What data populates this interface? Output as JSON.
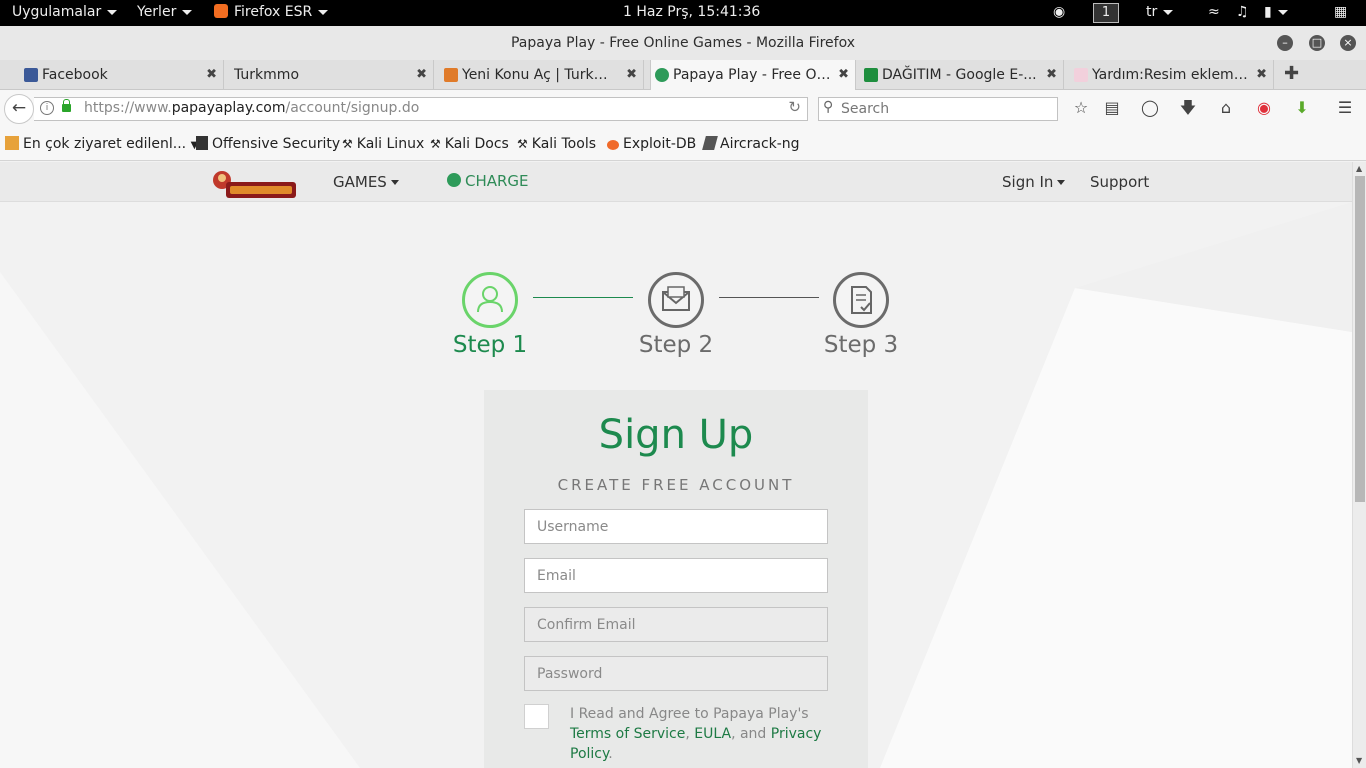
{
  "system_bar": {
    "applications": "Uygulamalar",
    "places": "Yerler",
    "active_app": "Firefox ESR",
    "clock": "1 Haz Prş, 15:41:36",
    "workspace": "1",
    "keyboard_layout": "tr"
  },
  "window": {
    "title": "Papaya Play - Free Online Games - Mozilla Firefox"
  },
  "tabs": [
    {
      "label": "Facebook",
      "favicon": "facebook-icon",
      "color": "#3b5998"
    },
    {
      "label": "Turkmmo",
      "favicon": "none",
      "color": ""
    },
    {
      "label": "Yeni Konu Aç | Turkm...",
      "favicon": "turkmmo-icon",
      "color": "#e07b2a"
    },
    {
      "label": "Papaya Play - Free On...",
      "favicon": "papaya-icon",
      "color": "#2e9b5a",
      "active": true
    },
    {
      "label": "DAĞITIM - Google E-...",
      "favicon": "sheets-icon",
      "color": "#1e8e3e"
    },
    {
      "label": "Yardım:Resim ekleme ...",
      "favicon": "wiki-icon",
      "color": "#cc3366"
    }
  ],
  "navbar": {
    "url_dim": "https://www.",
    "url_host": "papayaplay.com",
    "url_path": "/account/signup.do",
    "search_placeholder": "Search"
  },
  "bookmarks": [
    {
      "label": "En çok ziyaret edilenl...",
      "icon": "folder-icon"
    },
    {
      "label": "Offensive Security",
      "icon": "offsec-icon"
    },
    {
      "label": "Kali Linux",
      "icon": "kali-icon"
    },
    {
      "label": "Kali Docs",
      "icon": "kali-icon"
    },
    {
      "label": "Kali Tools",
      "icon": "kali-icon"
    },
    {
      "label": "Exploit-DB",
      "icon": "exploitdb-icon"
    },
    {
      "label": "Aircrack-ng",
      "icon": "aircrack-icon"
    }
  ],
  "site": {
    "nav": {
      "games": "GAMES",
      "charge": "CHARGE",
      "sign_in": "Sign In",
      "support": "Support"
    },
    "steps": [
      {
        "label": "Step 1",
        "icon": "user-icon",
        "active": true
      },
      {
        "label": "Step 2",
        "icon": "envelope-icon",
        "active": false
      },
      {
        "label": "Step 3",
        "icon": "document-check-icon",
        "active": false
      }
    ],
    "signup": {
      "title": "Sign Up",
      "subtitle": "CREATE FREE ACCOUNT",
      "username_placeholder": "Username",
      "email_placeholder": "Email",
      "confirm_email_placeholder": "Confirm Email",
      "password_placeholder": "Password",
      "agree_prefix": "I Read and Agree to Papaya Play's",
      "terms_link": "Terms of Service",
      "comma": ",",
      "eula_link": "EULA",
      "and_text": ", and",
      "privacy_link": "Privacy Policy",
      "period": "."
    }
  },
  "colors": {
    "accent_green": "#1d8a4e",
    "step_active_ring": "#6ad46a"
  }
}
